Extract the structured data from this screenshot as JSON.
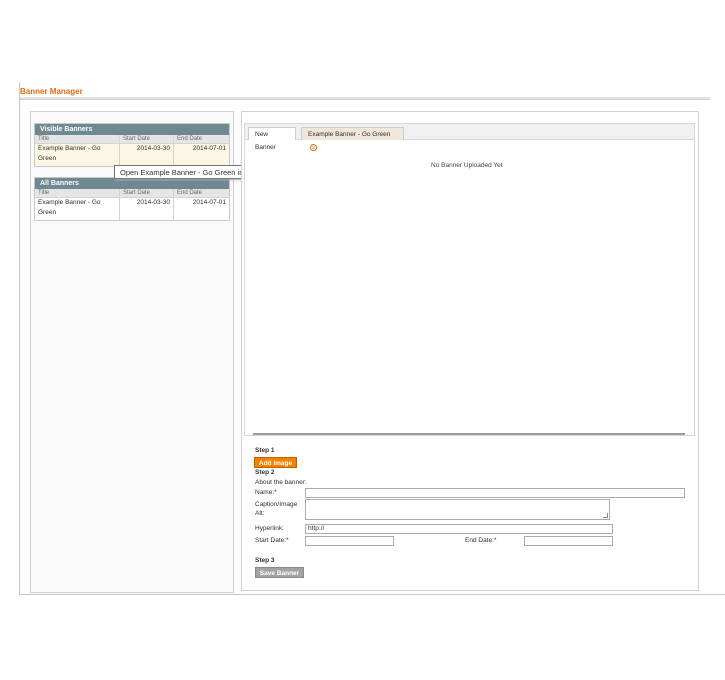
{
  "page": {
    "title": "Banner Manager"
  },
  "visible_banners": {
    "header": "Visible Banners",
    "columns": [
      "Title",
      "Start Date",
      "End Date"
    ],
    "rows": [
      {
        "title": "Example Banner - Go Green",
        "start": "2014-03-30",
        "end": "2014-07-01"
      }
    ]
  },
  "all_banners": {
    "header": "All Banners",
    "columns": [
      "Title",
      "Start Date",
      "End Date"
    ],
    "rows": [
      {
        "title": "Example Banner - Go Green",
        "start": "2014-03-30",
        "end": "2014-07-01"
      }
    ]
  },
  "tooltip": "Open Example Banner - Go Green in new tab",
  "tabs": [
    {
      "label": "New Banner",
      "active": true
    },
    {
      "label": "Example Banner - Go Green",
      "closable": true,
      "close_glyph": "⊙"
    }
  ],
  "preview": {
    "empty_message": "No Banner Uploaded Yet"
  },
  "form": {
    "step1": "Step 1",
    "add_image": "Add Image",
    "step2": "Step 2",
    "about": "About the banner:",
    "name_label": "Name:*",
    "caption_label_line1": "Caption/Image",
    "caption_label_line2": "Alt:",
    "hyperlink_label": "Hyperlink:",
    "hyperlink_value": "http://",
    "start_label": "Start Date:*",
    "end_label": "End Date:*",
    "step3": "Step 3",
    "save": "Save Banner"
  },
  "colors": {
    "accent": "#e26a12",
    "grid_header": "#6f8992",
    "button_orange": "#f18200",
    "button_gray": "#a3a3a3"
  }
}
